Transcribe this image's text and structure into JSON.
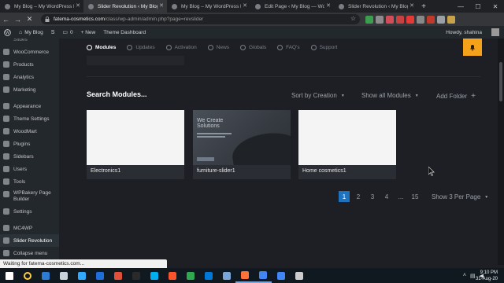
{
  "browser": {
    "tabs": [
      {
        "label": "My Blog – My WordPress Blog",
        "active": false
      },
      {
        "label": "Slider Revolution ‹ My Blog —",
        "active": true
      },
      {
        "label": "My Blog – My WordPress Blog",
        "active": false
      },
      {
        "label": "Edit Page ‹ My Blog — WordPr",
        "active": false
      },
      {
        "label": "Slider Revolution ‹ My Blog —",
        "active": false
      }
    ],
    "url_host": "fatema-cosmetics.com",
    "url_path": "/class/wp-admin/admin.php?page=revslider",
    "ext_colors": [
      "#3b9d4d",
      "#8c8c8c",
      "#d24d57",
      "#c94040",
      "#e53935",
      "#888888",
      "#c0392b",
      "#9aa0a6",
      "#c6a34a"
    ]
  },
  "adminbar": {
    "site": "My Blog",
    "new": "+ New",
    "theme": "Theme Dashboard",
    "comments": "0",
    "howdy": "Howdy, shahina"
  },
  "sidebar": {
    "top_clip": "Slides",
    "items": [
      {
        "label": "WooCommerce"
      },
      {
        "label": "Products"
      },
      {
        "label": "Analytics"
      },
      {
        "label": "Marketing"
      },
      {
        "label": "Appearance"
      },
      {
        "label": "Theme Settings"
      },
      {
        "label": "WoodMart"
      },
      {
        "label": "Plugins"
      },
      {
        "label": "Sidebars"
      },
      {
        "label": "Users"
      },
      {
        "label": "Tools"
      },
      {
        "label": "WPBakery Page Builder"
      },
      {
        "label": "Settings"
      },
      {
        "label": "MC4WP"
      },
      {
        "label": "Slider Revolution"
      },
      {
        "label": "Collapse menu"
      }
    ]
  },
  "modnav": [
    {
      "label": "Modules",
      "active": true
    },
    {
      "label": "Updates",
      "active": false
    },
    {
      "label": "Activation",
      "active": false
    },
    {
      "label": "News",
      "active": false
    },
    {
      "label": "Globals",
      "active": false
    },
    {
      "label": "FAQ's",
      "active": false
    },
    {
      "label": "Support",
      "active": false
    }
  ],
  "search": {
    "title": "Search Modules...",
    "sort": "Sort by Creation",
    "filter": "Show all Modules",
    "add_folder": "Add Folder"
  },
  "modules": [
    {
      "name": "Electronics1"
    },
    {
      "name": "furniture-slider1",
      "thumb_text": "We Create Solutions"
    },
    {
      "name": "Home cosmetics1"
    }
  ],
  "pagination": {
    "pages": [
      "1",
      "2",
      "3",
      "4",
      "...",
      "15"
    ],
    "current": "1",
    "per_page": "Show 3 Per Page"
  },
  "status": "Waiting for fatema-cosmetics.com...",
  "taskbar": {
    "time": "9:10 PM",
    "date": "31-Aug-20",
    "icon_colors": [
      "#ffffff",
      "#ffcc44",
      "#2b7cd3",
      "#c8d1dc",
      "#31a8ff",
      "#1d6fdc",
      "#e04f38",
      "#2a2a2a",
      "#00aff0",
      "#fb542b",
      "#2fa84f",
      "#0078d7",
      "#7aa7d8",
      "#ff7139",
      "#4285f4",
      "#4285f4",
      "#cccccc"
    ]
  }
}
